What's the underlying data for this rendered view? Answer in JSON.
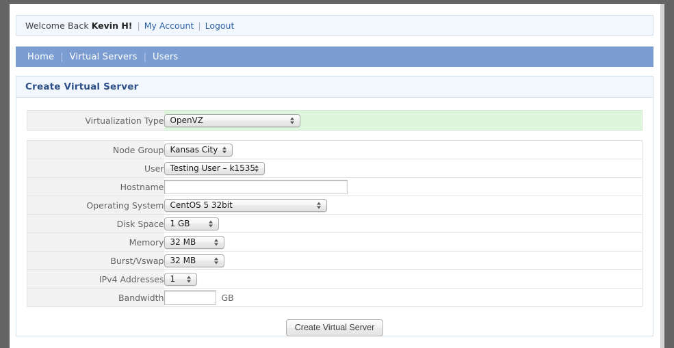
{
  "welcome": {
    "greeting": "Welcome Back",
    "user": "Kevin H!",
    "separator": "|",
    "my_account": "My Account",
    "logout": "Logout"
  },
  "nav": {
    "separator": "|",
    "items": [
      {
        "label": "Home"
      },
      {
        "label": "Virtual Servers"
      },
      {
        "label": "Users"
      }
    ]
  },
  "panel": {
    "title": "Create Virtual Server"
  },
  "highlight_row": {
    "label": "Virtualization Type",
    "value": "OpenVZ"
  },
  "form": {
    "rows": [
      {
        "label": "Node Group",
        "type": "select",
        "value": "Kansas City",
        "width": "w-node"
      },
      {
        "label": "User",
        "type": "select",
        "value": "Testing User – k1535",
        "width": "w-user"
      },
      {
        "label": "Hostname",
        "type": "text",
        "value": "",
        "placeholder": "",
        "width": "hostname"
      },
      {
        "label": "Operating System",
        "type": "select",
        "value": "CentOS 5 32bit",
        "width": "w-os"
      },
      {
        "label": "Disk Space",
        "type": "select",
        "value": "1 GB",
        "width": "w-disk"
      },
      {
        "label": "Memory",
        "type": "select",
        "value": "32 MB",
        "width": "w-mem"
      },
      {
        "label": "Burst/Vswap",
        "type": "select",
        "value": "32 MB",
        "width": "w-mem"
      },
      {
        "label": "IPv4 Addresses",
        "type": "select",
        "value": "1",
        "width": "w-ip"
      },
      {
        "label": "Bandwidth",
        "type": "text",
        "value": "",
        "placeholder": "",
        "width": "bandwidth",
        "unit": "GB"
      }
    ]
  },
  "submit": {
    "label": "Create Virtual Server"
  },
  "colors": {
    "desktop": "#656565",
    "nav_bar": "#7c9dd2",
    "panel_header_bg": "#f2f7fd",
    "panel_header_text": "#2b4f86",
    "panel_border": "#d3e0ee",
    "highlight_row_bg": "#ddf5dd",
    "label_cell_bg": "#f2f2f2",
    "link": "#2a5fa5"
  }
}
